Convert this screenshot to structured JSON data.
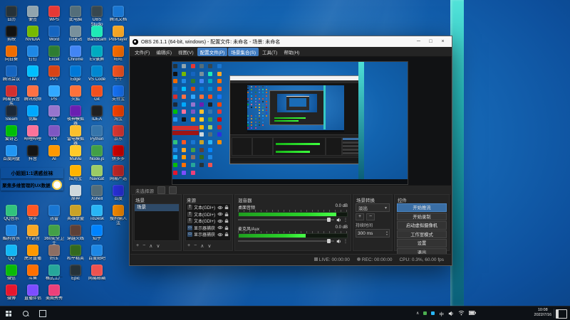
{
  "desktop": {
    "icons": [
      {
        "col": 0,
        "row": 0,
        "label": "日历",
        "color": "#263238"
      },
      {
        "col": 0,
        "row": 1,
        "label": "剪映",
        "color": "#111111"
      },
      {
        "col": 0,
        "row": 2,
        "label": "向日葵",
        "color": "#ef6c00"
      },
      {
        "col": 0,
        "row": 3,
        "label": "腾讯会议",
        "color": "#1565c0"
      },
      {
        "col": 0,
        "row": 4,
        "label": "网易云音乐",
        "color": "#d32f2f"
      },
      {
        "col": 0,
        "row": 5,
        "label": "Steam",
        "color": "#1b2838"
      },
      {
        "col": 0,
        "row": 6,
        "label": "爱奇艺",
        "color": "#00be06"
      },
      {
        "col": 0,
        "row": 7,
        "label": "百度网盘",
        "color": "#2196f3"
      },
      {
        "col": 0,
        "row": 10,
        "label": "QQ音乐",
        "color": "#31c27c"
      },
      {
        "col": 0,
        "row": 11,
        "label": "酷狗音乐",
        "color": "#1e88e5"
      },
      {
        "col": 0,
        "row": 12,
        "label": "QQ",
        "color": "#12b7f5"
      },
      {
        "col": 0,
        "row": 13,
        "label": "微信",
        "color": "#09bb07"
      },
      {
        "col": 0,
        "row": 14,
        "label": "微博",
        "color": "#e6162d"
      },
      {
        "col": 1,
        "row": 0,
        "label": "便签",
        "color": "#90a4ae"
      },
      {
        "col": 1,
        "row": 1,
        "label": "NVIDIA",
        "color": "#76b900"
      },
      {
        "col": 1,
        "row": 2,
        "label": "钉钉",
        "color": "#1e88e5"
      },
      {
        "col": 1,
        "row": 3,
        "label": "TIM",
        "color": "#00bfff"
      },
      {
        "col": 1,
        "row": 4,
        "label": "腾讯视频",
        "color": "#ff7043"
      },
      {
        "col": 1,
        "row": 5,
        "label": "优酷",
        "color": "#00a8ff"
      },
      {
        "col": 1,
        "row": 6,
        "label": "哔哩哔哩",
        "color": "#fb7299"
      },
      {
        "col": 1,
        "row": 7,
        "label": "抖音",
        "color": "#141414"
      },
      {
        "col": 1,
        "row": 10,
        "label": "快手",
        "color": "#ff5722"
      },
      {
        "col": 1,
        "row": 11,
        "label": "YY语音",
        "color": "#f9a825"
      },
      {
        "col": 1,
        "row": 12,
        "label": "虎牙直播",
        "color": "#ff9800"
      },
      {
        "col": 1,
        "row": 13,
        "label": "斗鱼",
        "color": "#ff6f00"
      },
      {
        "col": 1,
        "row": 14,
        "label": "直播伴侣",
        "color": "#7c4dff"
      },
      {
        "col": 2,
        "row": 0,
        "label": "WPS",
        "color": "#e53935"
      },
      {
        "col": 2,
        "row": 1,
        "label": "Word",
        "color": "#1565c0"
      },
      {
        "col": 2,
        "row": 2,
        "label": "Excel",
        "color": "#2e7d32"
      },
      {
        "col": 2,
        "row": 3,
        "label": "PPT",
        "color": "#d84315"
      },
      {
        "col": 2,
        "row": 4,
        "label": "PS",
        "color": "#31a8ff"
      },
      {
        "col": 2,
        "row": 5,
        "label": "AE",
        "color": "#9575cd"
      },
      {
        "col": 2,
        "row": 6,
        "label": "PR",
        "color": "#7e57c2"
      },
      {
        "col": 2,
        "row": 7,
        "label": "AI",
        "color": "#ff9800"
      },
      {
        "col": 2,
        "row": 10,
        "label": "迅雷",
        "color": "#1976d2"
      },
      {
        "col": 2,
        "row": 11,
        "label": "360安全卫士",
        "color": "#43a047"
      },
      {
        "col": 2,
        "row": 12,
        "label": "好压",
        "color": "#8d6e63"
      },
      {
        "col": 2,
        "row": 13,
        "label": "格式工厂",
        "color": "#26a69a"
      },
      {
        "col": 2,
        "row": 14,
        "label": "美图秀秀",
        "color": "#ec407a"
      },
      {
        "col": 3,
        "row": 0,
        "label": "此电脑",
        "color": "#546e7a"
      },
      {
        "col": 3,
        "row": 1,
        "label": "回收站",
        "color": "#78909c"
      },
      {
        "col": 3,
        "row": 2,
        "label": "Chrome",
        "color": "#4285f4"
      },
      {
        "col": 3,
        "row": 3,
        "label": "Edge",
        "color": "#0078d7"
      },
      {
        "col": 3,
        "row": 4,
        "label": "火狐",
        "color": "#ff7139"
      },
      {
        "col": 3,
        "row": 5,
        "label": "夜神模拟器",
        "color": "#6a1fb1"
      },
      {
        "col": 3,
        "row": 6,
        "label": "雷电模拟器",
        "color": "#fbc02d"
      },
      {
        "col": 3,
        "row": 7,
        "label": "MuMu",
        "color": "#ffca28"
      },
      {
        "col": 3,
        "row": 8,
        "label": "应用宝",
        "color": "#ffb300"
      },
      {
        "col": 3,
        "row": 9,
        "label": "原神",
        "color": "#cfd8dc"
      },
      {
        "col": 3,
        "row": 10,
        "label": "英雄联盟",
        "color": "#c9a227"
      },
      {
        "col": 3,
        "row": 11,
        "label": "穿越火线",
        "color": "#5d4037"
      },
      {
        "col": 3,
        "row": 12,
        "label": "和平精英",
        "color": "#33691e"
      },
      {
        "col": 3,
        "row": 13,
        "label": "Epic",
        "color": "#263238"
      },
      {
        "col": 4,
        "row": 0,
        "label": "OBS Studio",
        "color": "#37474f"
      },
      {
        "col": 4,
        "row": 1,
        "label": "Bandicam",
        "color": "#1de9b6"
      },
      {
        "col": 4,
        "row": 2,
        "label": "EV录屏",
        "color": "#00acc1"
      },
      {
        "col": 4,
        "row": 3,
        "label": "VS Code",
        "color": "#0288d1"
      },
      {
        "col": 4,
        "row": 4,
        "label": "Git",
        "color": "#f4511e"
      },
      {
        "col": 4,
        "row": 5,
        "label": "IDEA",
        "color": "#212121"
      },
      {
        "col": 4,
        "row": 6,
        "label": "Python",
        "color": "#3776ab"
      },
      {
        "col": 4,
        "row": 7,
        "label": "Node.js",
        "color": "#43a047"
      },
      {
        "col": 4,
        "row": 8,
        "label": "Navicat",
        "color": "#9ccc65"
      },
      {
        "col": 4,
        "row": 9,
        "label": "Xshell",
        "color": "#546e7a"
      },
      {
        "col": 4,
        "row": 10,
        "label": "ToDesk",
        "color": "#29b6f6"
      },
      {
        "col": 4,
        "row": 11,
        "label": "知乎",
        "color": "#0084ff"
      },
      {
        "col": 4,
        "row": 12,
        "label": "百度贴吧",
        "color": "#1e88e5"
      },
      {
        "col": 4,
        "row": 13,
        "label": "网易邮箱",
        "color": "#ef5350"
      },
      {
        "col": 5,
        "row": 0,
        "label": "腾讯文档",
        "color": "#1976d2"
      },
      {
        "col": 5,
        "row": 1,
        "label": "PotPlayer",
        "color": "#f9a825"
      },
      {
        "col": 5,
        "row": 2,
        "label": "旺旺",
        "color": "#ff6f00"
      },
      {
        "col": 5,
        "row": 3,
        "label": "千牛",
        "color": "#ff5722"
      },
      {
        "col": 5,
        "row": 4,
        "label": "支付宝",
        "color": "#1677ff"
      },
      {
        "col": 5,
        "row": 5,
        "label": "淘宝",
        "color": "#ff4400"
      },
      {
        "col": 5,
        "row": 6,
        "label": "京东",
        "color": "#e53935"
      },
      {
        "col": 5,
        "row": 7,
        "label": "拼多多",
        "color": "#d50000"
      },
      {
        "col": 5,
        "row": 8,
        "label": "网易严选",
        "color": "#c62828"
      },
      {
        "col": 5,
        "row": 9,
        "label": "百度",
        "color": "#2932e1"
      },
      {
        "col": 5,
        "row": 10,
        "label": "搜狗输入法",
        "color": "#fb8c00"
      }
    ],
    "banners": [
      {
        "text": "小姐姐1:1诱惑丝袜",
        "bg": "#d32f2f",
        "fg": "#ffeb3b"
      },
      {
        "text": "聚焦多维管理的UX数据",
        "bg": "#9e1414",
        "fg": "#ffd54f"
      }
    ]
  },
  "obs": {
    "title": "OBS 26.1.1 (64-bit, windows) - 配置文件: 未命名 - 场景: 未命名",
    "window_buttons": {
      "minimize": "─",
      "maximize": "□",
      "close": "×"
    },
    "menu": [
      "文件(F)",
      "编辑(E)",
      "视图(V)",
      "配置文件(P)",
      "场景集合(S)",
      "工具(T)",
      "帮助(H)"
    ],
    "source_toolbar": "未选择源",
    "docks": {
      "scenes": {
        "title": "场景",
        "items": [
          "场景"
        ],
        "foot": [
          "+",
          "−",
          "∧",
          "∨"
        ]
      },
      "sources": {
        "title": "来源",
        "foot": [
          "+",
          "−",
          "∧",
          "∨"
        ],
        "items": [
          {
            "type": "text",
            "label": "文本(GDI+) 3"
          },
          {
            "type": "text",
            "label": "文本(GDI+) 2"
          },
          {
            "type": "text",
            "label": "文本(GDI+)"
          },
          {
            "type": "display",
            "label": "显示器捕获 2"
          },
          {
            "type": "display",
            "label": "显示器捕获"
          }
        ]
      },
      "mixer": {
        "title": "混音器",
        "channels": [
          {
            "name": "桌面音频",
            "db": "0.0 dB",
            "level": 0.9
          },
          {
            "name": "麦克风/Aux",
            "db": "0.0 dB",
            "level": 0.62
          }
        ]
      },
      "transitions": {
        "title": "场景转换",
        "selected": "淡出",
        "add": "+",
        "remove": "−",
        "duration_label": "持续时间",
        "duration": "300 ms"
      },
      "controls": {
        "title": "控件",
        "buttons": [
          "开始推流",
          "开始录制",
          "启动虚拟摄像机",
          "工作室模式",
          "设置",
          "退出"
        ]
      }
    },
    "status": {
      "live_label": "LIVE:",
      "live": "00:00:00",
      "rec_label": "REC:",
      "rec": "00:00:00",
      "cpu": "CPU: 0.3%, 60.00 fps"
    }
  },
  "taskbar": {
    "time": "10:08",
    "date": "2022/7/16",
    "input": "中"
  }
}
